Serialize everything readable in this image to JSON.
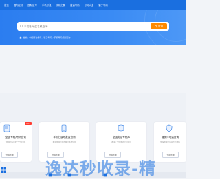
{
  "nav": {
    "items": [
      "首页",
      "国内区号",
      "国际区号",
      "手机号段",
      "手机归属",
      "普通号码",
      "号码大全",
      "骗子号码"
    ]
  },
  "search": {
    "placeholder": "手机号/地区名称/区号",
    "button_label": "查询"
  },
  "breadcrumb": {
    "text": "当前：中国移动号码 / 骗子号码 / 手机号码规则查询"
  },
  "cards": [
    {
      "title": "全国号段/号码查询",
      "desc": "查询号码所属****的号码",
      "button": "立即查询",
      "badge": "HOT"
    },
    {
      "title": "手机归属地批量查询",
      "desc": "批量查询号码所属归属地信息",
      "button": "立即查询"
    },
    {
      "title": "全国电话号码库",
      "desc": "收录了全国电话号码信息",
      "button": "立即查询"
    },
    {
      "title": "骚扰诈电话查询",
      "desc": "快速查询号码是否为诈骗",
      "button": "立即查询"
    }
  ],
  "watermark": {
    "text": "逸达秒收录-精"
  },
  "colors": {
    "nav": "#1a6fe0",
    "hero": "#2b7df0",
    "accent": "#ff8a00"
  },
  "icons": [
    "search-icon",
    "mic-icon",
    "home-icon",
    "document-icon",
    "phone-icon",
    "database-icon",
    "shield-icon"
  ]
}
